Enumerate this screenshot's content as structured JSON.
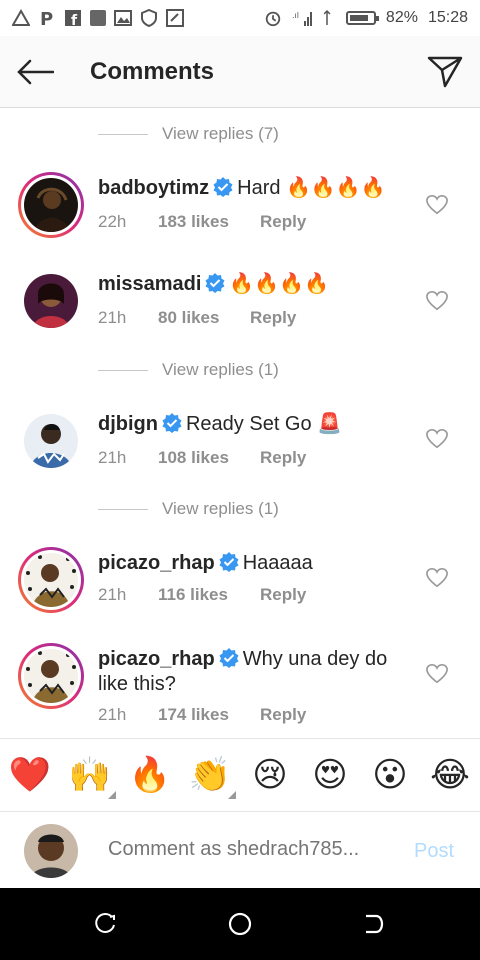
{
  "status_bar": {
    "battery": "82%",
    "time": "15:28",
    "battery_level": 0.82
  },
  "header": {
    "title": "Comments"
  },
  "view_replies": [
    {
      "label": "View replies (7)"
    },
    {
      "label": "View replies (1)"
    },
    {
      "label": "View replies (1)"
    }
  ],
  "comments": [
    {
      "username": "badboytimz",
      "text": "Hard 🔥🔥🔥🔥",
      "time": "22h",
      "likes": "183 likes",
      "reply": "Reply"
    },
    {
      "username": "missamadi",
      "text": "🔥🔥🔥🔥",
      "time": "21h",
      "likes": "80 likes",
      "reply": "Reply"
    },
    {
      "username": "djbign",
      "text": "Ready Set Go 🚨",
      "time": "21h",
      "likes": "108 likes",
      "reply": "Reply"
    },
    {
      "username": "picazo_rhap",
      "text": "Haaaaa",
      "time": "21h",
      "likes": "116 likes",
      "reply": "Reply"
    },
    {
      "username": "picazo_rhap",
      "text": "Why una dey do like this?",
      "time": "21h",
      "likes": "174 likes",
      "reply": "Reply"
    }
  ],
  "emoji_bar": [
    "❤️",
    "🙌",
    "🔥",
    "👏",
    "😢",
    "😍",
    "😮",
    "😂"
  ],
  "comment_bar": {
    "placeholder": "Comment as shedrach785...",
    "post_label": "Post"
  },
  "colors": {
    "verified": "#3897f0",
    "post_disabled": "#b3dbff"
  }
}
